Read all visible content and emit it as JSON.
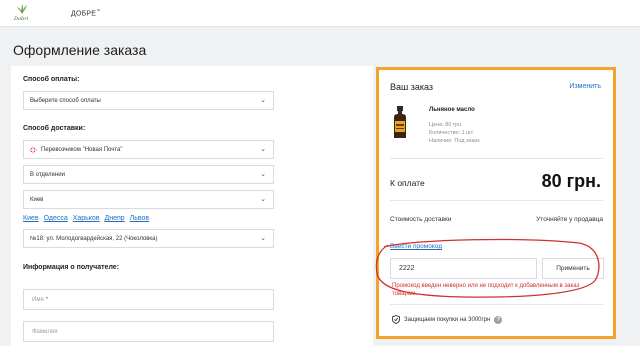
{
  "header": {
    "logo_text": "Dobri",
    "brand": "ДОБРЕ"
  },
  "page": {
    "title": "Оформление заказа"
  },
  "form": {
    "payment_label": "Способ оплаты:",
    "payment_select": "Выберите способ оплаты",
    "delivery_label": "Способ доставки:",
    "carrier_select": "Перевозчиком \"Новая Почта\"",
    "delivery_type_select": "В отделении",
    "city_select": "Киев",
    "city_links": [
      "Киев",
      "Одесса",
      "Харьков",
      "Днепр",
      "Львов"
    ],
    "branch_select": "№18: ул. Молодогвардейская, 22 (Чоколовка)",
    "recipient_label": "Информация о получателе:",
    "name_placeholder": "Имя",
    "name_required_mark": "*",
    "surname_placeholder": "Фамилия"
  },
  "order": {
    "title": "Ваш заказ",
    "edit_label": "Изменить",
    "product": {
      "name": "Льняное масло",
      "price": "Цена: 80 грн.",
      "quantity": "Количество: 1 шт.",
      "availability": "Наличие: Под заказ"
    },
    "pay_label": "К оплате",
    "pay_amount": "80 грн.",
    "shipping_label": "Стоимость доставки",
    "shipping_value": "Уточняйте у продавца",
    "promo_link": "Ввести промокод",
    "promo_value": "2222",
    "promo_button": "Применить",
    "promo_error": "Промокод введен неверно или не подходит к добавленным в заказ товарам.",
    "secure_text": "Защищаем покупки на 3000грн",
    "help_mark": "?"
  },
  "colors": {
    "highlight_border": "#f2a52a",
    "link": "#1f6fc4",
    "error": "#d0312d",
    "annotation": "#d0312d"
  },
  "icons": [
    "leaf-logo-icon",
    "chevron-down-icon",
    "nova-poshta-icon",
    "shield-icon",
    "help-icon",
    "product-bottle-image"
  ]
}
